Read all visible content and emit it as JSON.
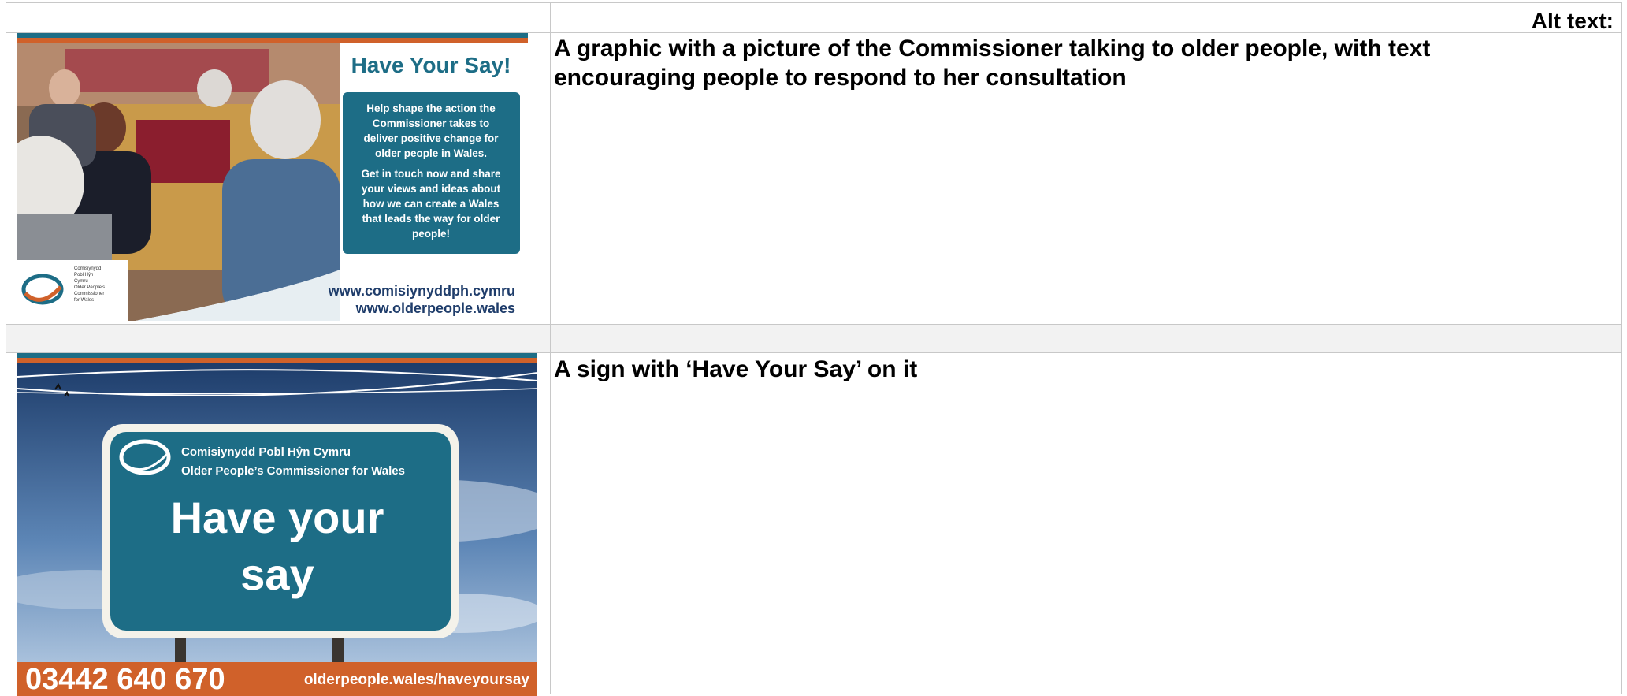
{
  "table": {
    "header_label": "Alt text:",
    "rows": [
      {
        "alt_text": "A graphic with a picture of the Commissioner talking to older people, with text encouraging people to respond to her consultation",
        "graphic": {
          "heading": "Have Your Say!",
          "body_lines_1": [
            "Help shape the action the",
            "Commissioner takes to",
            "deliver positive change for",
            "older people in Wales."
          ],
          "body_lines_2": [
            "Get in touch now and share",
            "your views and ideas about",
            "how we can create a Wales",
            "that leads the way for older",
            "people!"
          ],
          "url_1": "www.comisiynyddph.cymru",
          "url_2": "www.olderpeople.wales",
          "logo_lines": [
            "Comisiynydd",
            "Pobl Hŷn",
            "Cymru",
            "Older People's",
            "Commissioner",
            "for Wales"
          ]
        }
      },
      {
        "alt_text": "A sign with ‘Have Your Say’ on it",
        "graphic": {
          "org_line_1": "Comisiynydd Pobl Hŷn Cymru",
          "org_line_2": "Older People’s Commissioner for Wales",
          "sign_line_1": "Have your",
          "sign_line_2": "say",
          "phone": "03442 640 670",
          "url": "olderpeople.wales/haveyoursay"
        }
      }
    ]
  },
  "colors": {
    "teal": "#1d6d86",
    "orange": "#d0612a",
    "navy": "#1f3d6b",
    "grid": "#c8c8c8",
    "blank_row": "#f2f2f2"
  }
}
